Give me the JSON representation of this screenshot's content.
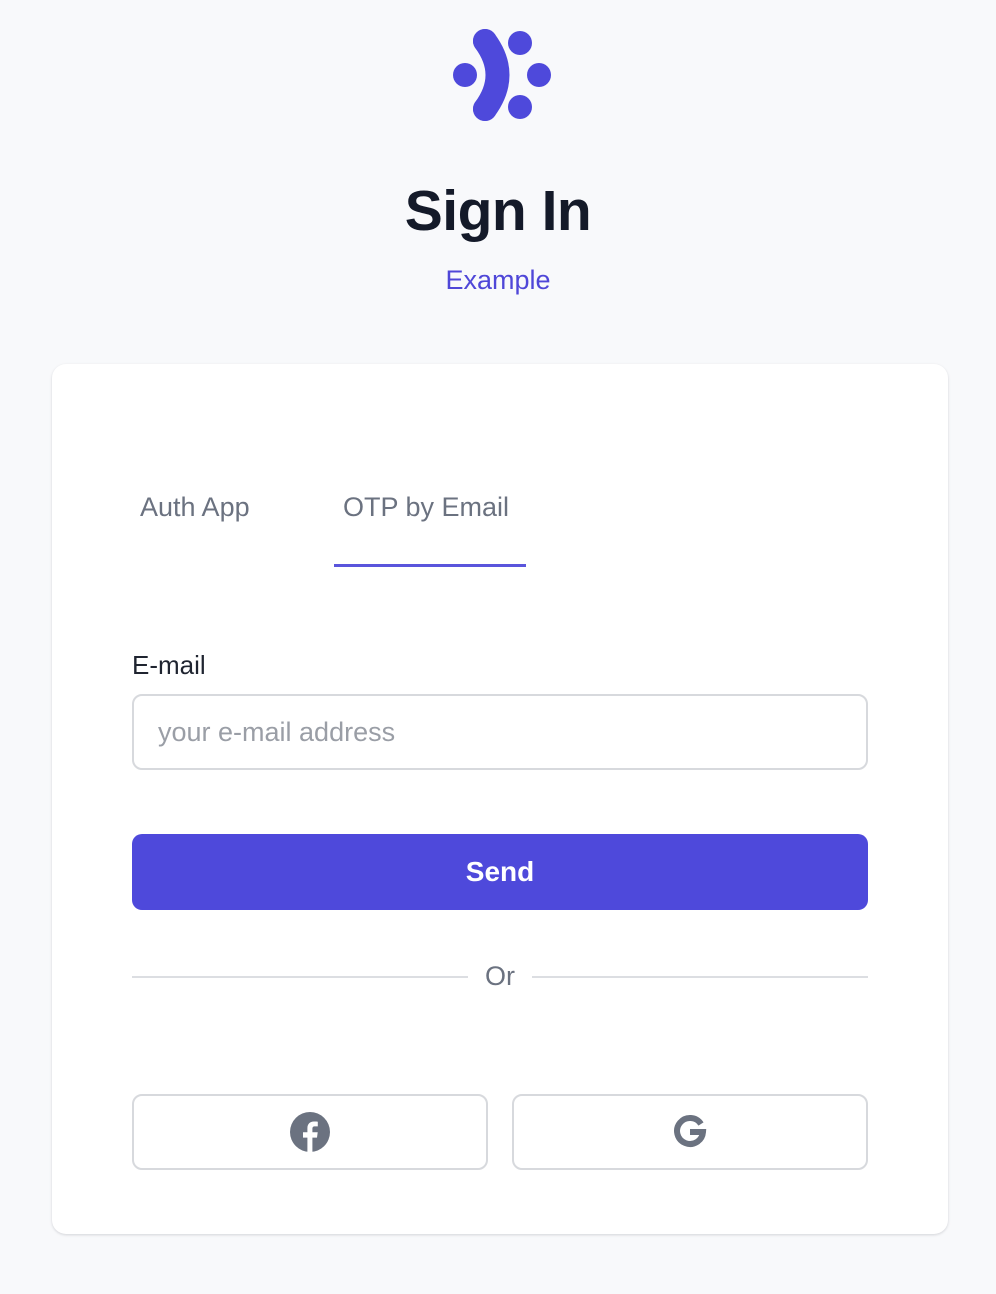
{
  "header": {
    "logo_icon": "brand-logo-icon",
    "title": "Sign In",
    "subtitle": "Example"
  },
  "tabs": [
    {
      "label": "Auth App",
      "active": false
    },
    {
      "label": "OTP by Email",
      "active": true
    }
  ],
  "form": {
    "email_label": "E-mail",
    "email_value": "",
    "email_placeholder": "your e-mail address",
    "submit_label": "Send"
  },
  "divider": {
    "text": "Or"
  },
  "social": [
    {
      "provider": "facebook",
      "icon": "facebook-icon"
    },
    {
      "provider": "google",
      "icon": "google-icon"
    }
  ],
  "colors": {
    "accent": "#4e49db",
    "title": "#141a29",
    "muted": "#6b7280",
    "background": "#f8f9fb"
  }
}
